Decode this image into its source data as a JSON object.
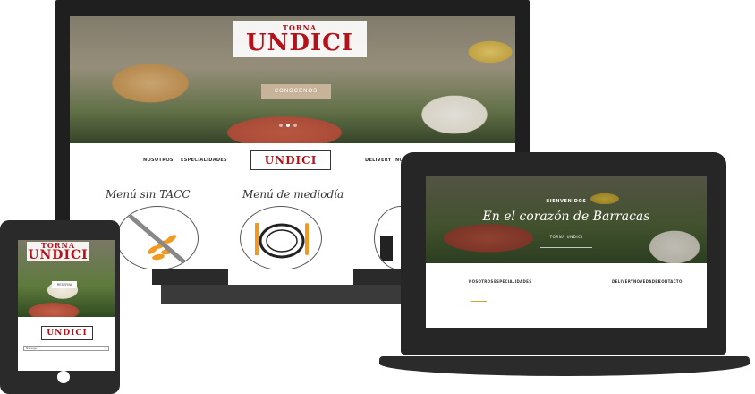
{
  "logo": {
    "top_text": "TORNA",
    "main_text": "UNDICI"
  },
  "desktop": {
    "cta": "CONOCENOS",
    "nav_left": [
      "NOSOTROS",
      "ESPECIALIDADES"
    ],
    "nav_right": [
      "DELIVERY",
      "NO"
    ],
    "menu_titles": [
      "Menú sin TACC",
      "Menú de mediodía"
    ]
  },
  "laptop": {
    "kicker": "BIENVENIDOS",
    "headline": "En el corazón de Barracas",
    "sub": "TORNA UNDICI",
    "nav_left": [
      "NOSOTROS",
      "ESPECIALIDADES"
    ],
    "nav_right": [
      "DELIVERY",
      "NOVEDADES",
      "CONTACTO"
    ]
  },
  "tablet": {
    "cta": "RESERVA",
    "select_value": "Navegar"
  },
  "colors": {
    "brand_red": "#b3121b",
    "accent_gold": "#d6a33a",
    "device_dark": "#262626"
  }
}
